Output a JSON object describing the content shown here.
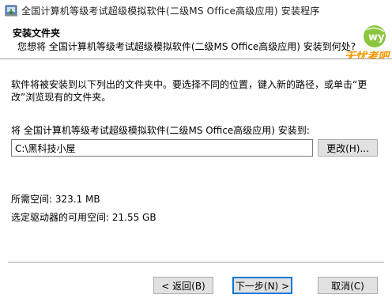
{
  "window": {
    "title": "全国计算机等级考试超级模拟软件(二级MS Office高级应用) 安装程序"
  },
  "header": {
    "title": "安装文件夹",
    "subtitle": "您想将 全国计算机等级考试超级模拟软件(二级MS Office高级应用) 安装到何处?",
    "logo_badge": "wy",
    "logo_text": "无忧考吧"
  },
  "content": {
    "description": "软件将被安装到以下列出的文件夹中。要选择不同的位置，键入新的路径，或单击“更改”浏览现有的文件夹。",
    "install_label": "将 全国计算机等级考试超级模拟软件(二级MS Office高级应用) 安装到:",
    "install_path": "C:\\黑科技小屋",
    "browse_label": "更改(H)...",
    "space_required": "所需空间: 323.1 MB",
    "space_available": "选定驱动器的可用空间: 21.55 GB"
  },
  "footer": {
    "back_label": "< 返回(B)",
    "next_label": "下一步(N) >",
    "cancel_label": "取消(C)"
  },
  "colors": {
    "accent": "#0078d7",
    "logo_green": "#8cc63f",
    "logo_orange": "#f39800",
    "logo_red": "#e8340c"
  },
  "icons": {
    "title_icon": "installer-icon"
  }
}
